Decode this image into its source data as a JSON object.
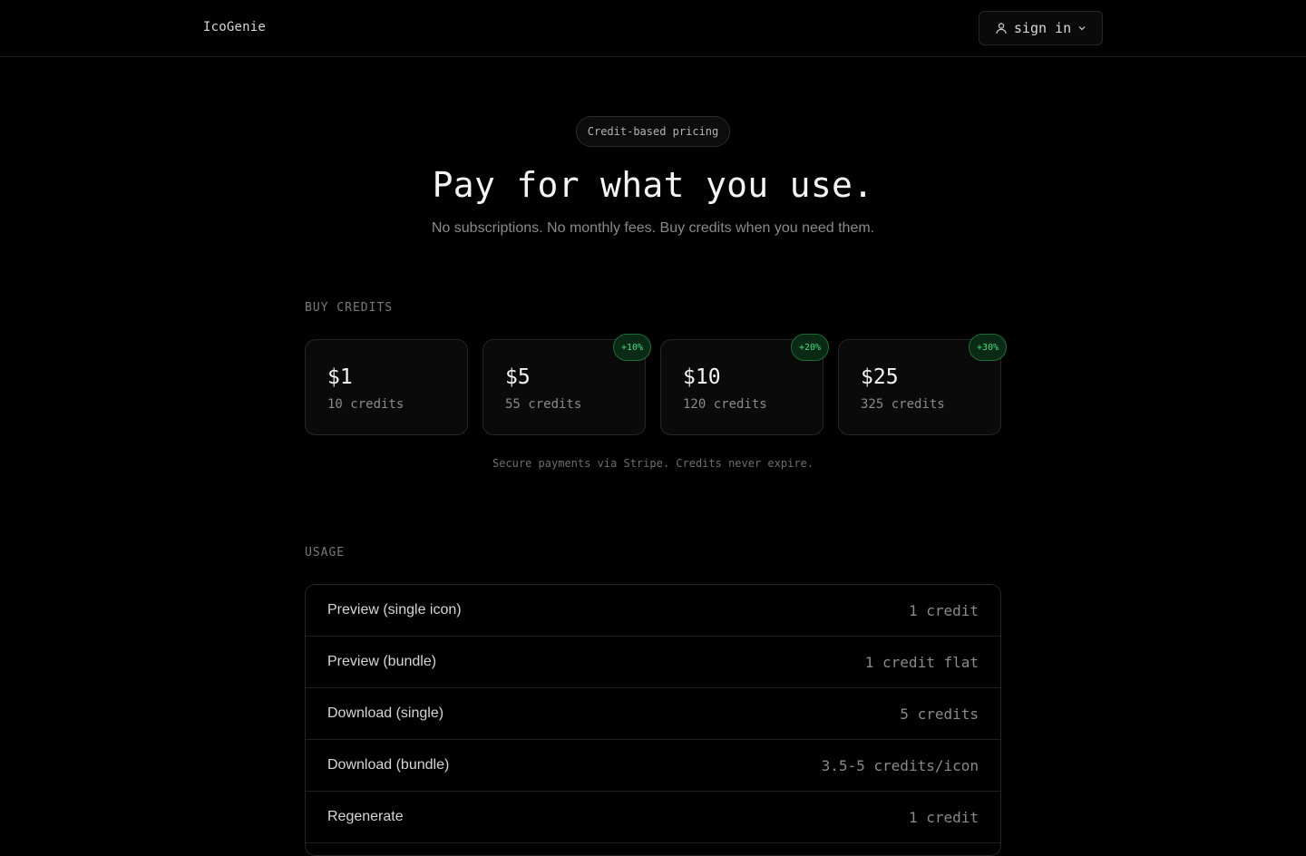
{
  "header": {
    "logo": "IcoGenie",
    "sign_in_label": "sign in",
    "user_icon": "user-icon",
    "chevron_icon": "chevron-down-icon"
  },
  "hero": {
    "pill": "Credit-based pricing",
    "title": "Pay for what you use.",
    "subtitle": "No subscriptions. No monthly fees. Buy credits when you need them."
  },
  "buy": {
    "label": "BUY CREDITS",
    "packages": [
      {
        "price": "$1",
        "credits": "10 credits",
        "bonus": ""
      },
      {
        "price": "$5",
        "credits": "55 credits",
        "bonus": "+10%"
      },
      {
        "price": "$10",
        "credits": "120 credits",
        "bonus": "+20%"
      },
      {
        "price": "$25",
        "credits": "325 credits",
        "bonus": "+30%"
      }
    ],
    "note": "Secure payments via Stripe. Credits never expire."
  },
  "usage": {
    "label": "USAGE",
    "rows": [
      {
        "name": "Preview (single icon)",
        "cost": "1 credit"
      },
      {
        "name": "Preview (bundle)",
        "cost": "1 credit flat"
      },
      {
        "name": "Download (single)",
        "cost": "5 credits"
      },
      {
        "name": "Download (bundle)",
        "cost": "3.5-5 credits/icon"
      },
      {
        "name": "Regenerate",
        "cost": "1 credit"
      }
    ]
  },
  "colors": {
    "background": "#000000",
    "accent_green": "#4ade80",
    "badge_bg": "#0b2a15",
    "border": "#262626"
  }
}
